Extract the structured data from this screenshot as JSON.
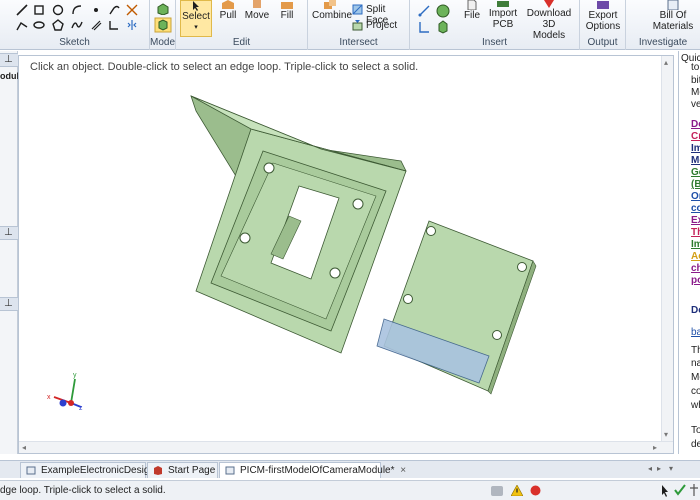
{
  "ribbon": {
    "groups": {
      "sketch": "Sketch",
      "mode": "Mode",
      "edit": "Edit",
      "intersect": "Intersect",
      "insert": "Insert",
      "output": "Output",
      "investigate": "Investigate"
    },
    "buttons": {
      "select": "Select",
      "pull": "Pull",
      "move": "Move",
      "fill": "Fill",
      "combine": "Combine",
      "split_face": "Split Face",
      "project": "Project",
      "file": "File",
      "import_pcb_1": "Import",
      "import_pcb_2": "PCB",
      "download_1": "Download 3D",
      "download_2": "Models",
      "export_1": "Export",
      "export_2": "Options",
      "bom_1": "Bill Of",
      "bom_2": "Materials"
    }
  },
  "left_strip": {
    "label": "odul"
  },
  "viewport": {
    "hint": "Click an object. Double-click to select an edge loop. Triple-click to select a solid."
  },
  "right_panel": {
    "title": "Quic",
    "lines": [
      "to",
      "bit",
      "Mo",
      "ve",
      "De",
      "Cr",
      "Im",
      "Mo",
      "Ge",
      "(B",
      "Or",
      "co",
      "Ex",
      "Th",
      "Im",
      "Ac",
      "ch",
      "po",
      "De",
      "ba",
      "Th",
      "na",
      "Mo",
      "co",
      "wh",
      "To",
      "de"
    ]
  },
  "doc_tabs": [
    {
      "label": "ExampleElectronicDesign"
    },
    {
      "label": "Start Page"
    },
    {
      "label": "PICM-firstModelOfCameraModule*"
    }
  ],
  "status": {
    "text": "dge loop. Triple-click to select a solid."
  },
  "colors": {
    "model_fill": "#b9d8ad",
    "model_edge": "#3d5a34",
    "accent": "#2d6cc2"
  }
}
